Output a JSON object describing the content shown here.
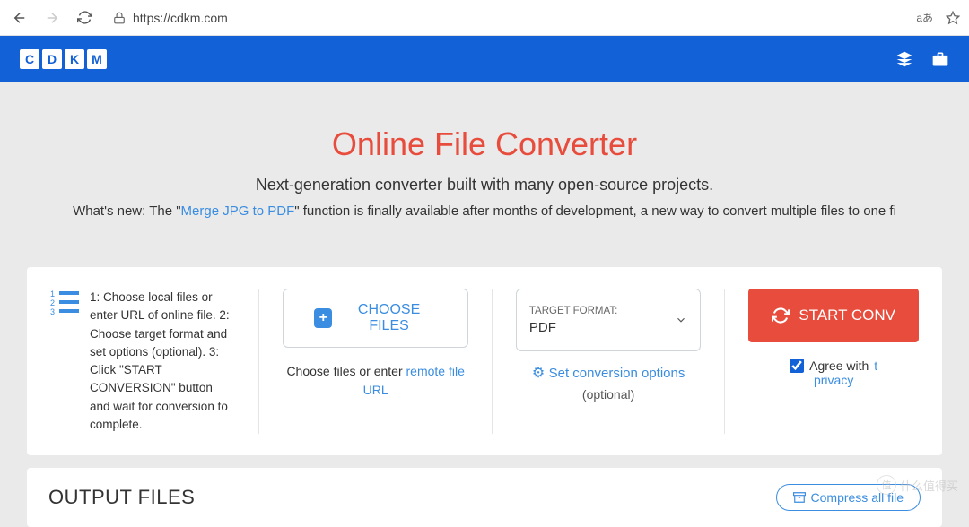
{
  "browser": {
    "url": "https://cdkm.com",
    "lang_indicator": "aあ"
  },
  "logo": [
    "C",
    "D",
    "K",
    "M"
  ],
  "hero": {
    "title": "Online File Converter",
    "tagline": "Next-generation converter built with many open-source projects.",
    "news_prefix": "What's new: The \"",
    "news_link": "Merge JPG to PDF",
    "news_suffix": "\" function is finally available after months of development, a new way to convert multiple files to one fi"
  },
  "steps": {
    "text": "1: Choose local files or enter URL of online file. 2: Choose target format and set options (optional). 3: Click \"START CONVERSION\" button and wait for conversion to complete."
  },
  "choose": {
    "button": "CHOOSE FILES",
    "sub_prefix": "Choose files or enter ",
    "sub_link": "remote file URL"
  },
  "target": {
    "label": "TARGET FORMAT:",
    "value": "PDF",
    "options_link": "Set conversion options",
    "optional": "(optional)"
  },
  "start": {
    "button": "START CONV",
    "agree_prefix": "Agree with ",
    "agree_link1": "t",
    "agree_link2": "privacy"
  },
  "output": {
    "title": "OUTPUT FILES",
    "compress": "Compress all file"
  },
  "watermark": "什么值得买"
}
